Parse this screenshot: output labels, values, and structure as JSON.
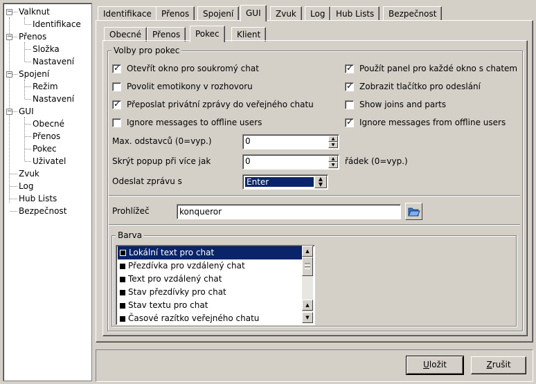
{
  "tree": [
    {
      "label": "Valknut",
      "level": 0,
      "expander": "-"
    },
    {
      "label": "Identifikace",
      "level": 1
    },
    {
      "label": "Přenos",
      "level": 0,
      "expander": "-"
    },
    {
      "label": "Složka",
      "level": 1
    },
    {
      "label": "Nastavení",
      "level": 1
    },
    {
      "label": "Spojení",
      "level": 0,
      "expander": "-"
    },
    {
      "label": "Režim",
      "level": 1
    },
    {
      "label": "Nastavení",
      "level": 1
    },
    {
      "label": "GUI",
      "level": 0,
      "expander": "-"
    },
    {
      "label": "Obecné",
      "level": 1
    },
    {
      "label": "Přenos",
      "level": 1
    },
    {
      "label": "Pokec",
      "level": 1
    },
    {
      "label": "Uživatel",
      "level": 1
    },
    {
      "label": "Zvuk",
      "level": 0
    },
    {
      "label": "Log",
      "level": 0
    },
    {
      "label": "Hub Lists",
      "level": 0
    },
    {
      "label": "Bezpečnost",
      "level": 0
    }
  ],
  "top_tabs": [
    "Identifikace",
    "Přenos",
    "Spojení",
    "GUI",
    "Zvuk",
    "Log",
    "Hub Lists",
    "Bezpečnost"
  ],
  "top_tabs_active": "GUI",
  "sub_tabs": [
    "Obecné",
    "Přenos",
    "Pokec",
    "Klient"
  ],
  "sub_tabs_active": "Pokec",
  "chat_group": {
    "title": "Volby pro pokec",
    "checkboxes_left": [
      {
        "label": "Otevřít okno pro soukromý chat",
        "checked": true
      },
      {
        "label": "Povolit emotikony v rozhovoru",
        "checked": false
      },
      {
        "label": "Přeposlat privátní zprávy do veřejného chatu",
        "checked": true
      },
      {
        "label": "Ignore messages to offline users",
        "checked": false
      }
    ],
    "checkboxes_right": [
      {
        "label": "Použít panel pro každé okno s chatem",
        "checked": true
      },
      {
        "label": "Zobrazit tlačítko pro odeslání",
        "checked": true
      },
      {
        "label": "Show joins and parts",
        "checked": false
      },
      {
        "label": "Ignore messages from offline users",
        "checked": true
      }
    ],
    "max_paragraphs_label": "Max. odstavců (0=vyp.)",
    "max_paragraphs_value": "0",
    "hide_popup_label": "Skrýt popup při více jak",
    "hide_popup_value": "0",
    "hide_popup_suffix": "řádek (0=vyp.)",
    "send_label": "Odeslat zprávu s",
    "send_value": "Enter",
    "browser_label": "Prohlížeč",
    "browser_value": "konqueror"
  },
  "color_group": {
    "title": "Barva",
    "items": [
      "Lokální text pro chat",
      "Přezdívka pro vzdálený chat",
      "Text pro vzdálený chat",
      "Stav přezdívky pro chat",
      "Stav textu pro chat",
      "Časové razítko veřejného chatu"
    ],
    "selected_index": 0
  },
  "buttons": {
    "save": "Uložit",
    "save_key": "U",
    "save_rest": "ložit",
    "cancel": "Zrušit",
    "cancel_key": "Z",
    "cancel_rest": "rušit"
  },
  "colors": {
    "bg": "#d4d0c8",
    "selection": "#0a246a"
  }
}
